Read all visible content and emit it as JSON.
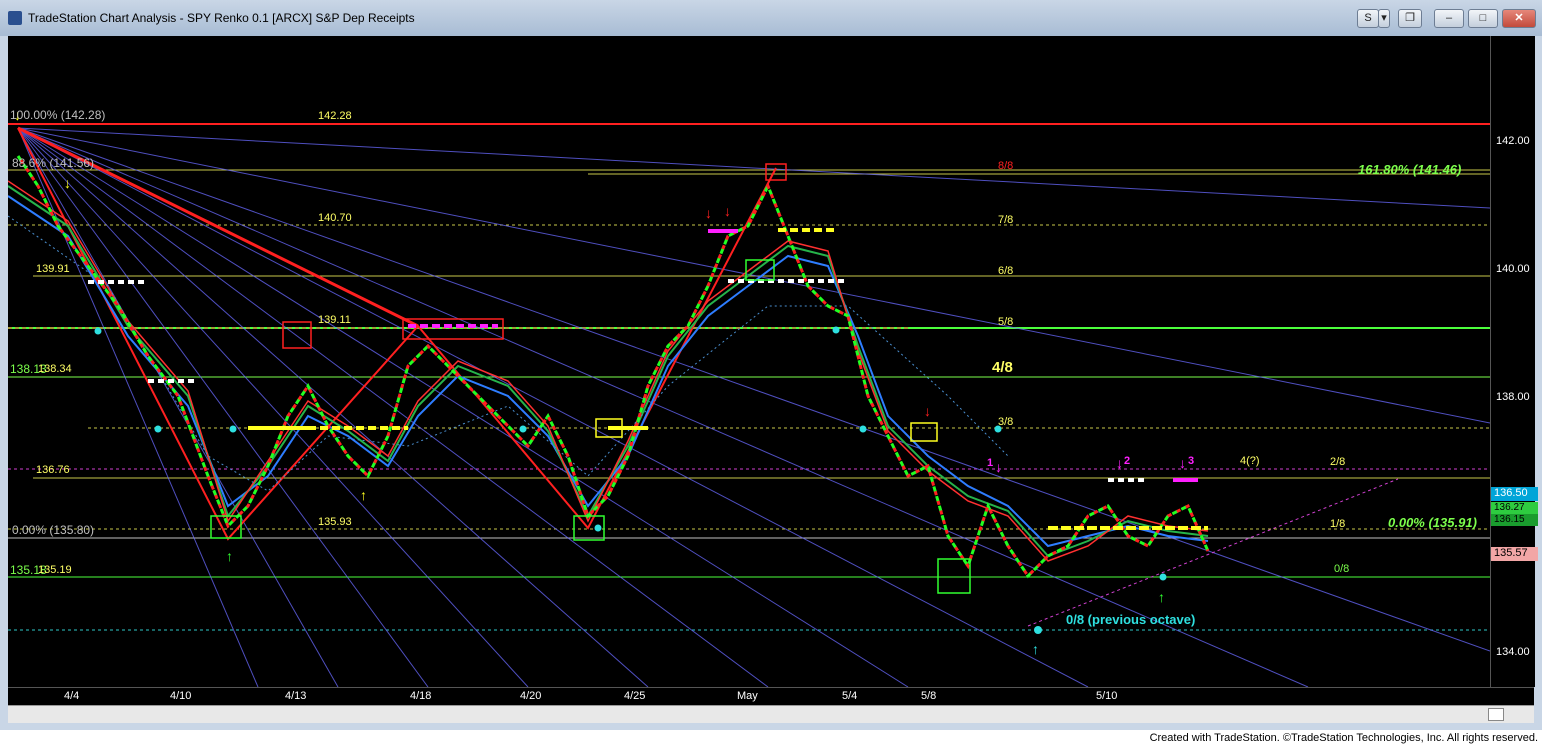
{
  "window": {
    "title": "TradeStation Chart Analysis - SPY Renko 0.1 [ARCX] S&P Dep Receipts",
    "buttons": {
      "s": "S",
      "menu": "▾",
      "restore": "❐",
      "minimize": "–",
      "maximize": "□",
      "close": "✕"
    }
  },
  "footer": "Created with TradeStation. ©TradeStation Technologies, Inc. All rights reserved.",
  "price_axis": {
    "ticks": [
      "142.00",
      "140.00",
      "138.00",
      "134.00"
    ],
    "badges": [
      {
        "text": "136.50",
        "bg": "#00a5d8"
      },
      {
        "text": "136.27",
        "bg": "#2ecc40"
      },
      {
        "text": "136.15",
        "bg": "#1a9c2e"
      },
      {
        "text": "135.57",
        "bg": "#f2a6a6"
      }
    ]
  },
  "date_axis": [
    "4/4",
    "4/10",
    "4/13",
    "4/18",
    "4/20",
    "4/25",
    "May",
    "5/4",
    "5/8",
    "5/10"
  ],
  "levels_left": [
    {
      "text": "100.00% (142.28)",
      "color": "#bfbfbf"
    },
    {
      "text": "142.28",
      "color": "#ffff66"
    },
    {
      "text": "88.6% (141.56)",
      "color": "#bfbfbf"
    },
    {
      "text": "140.70",
      "color": "#ffff66"
    },
    {
      "text": "139.91",
      "color": "#ffff66"
    },
    {
      "text": "139.11",
      "color": "#ffff66"
    },
    {
      "text": "138.13",
      "color": "#7cff4c"
    },
    {
      "text": "138.34",
      "color": "#ffff66"
    },
    {
      "text": "136.76",
      "color": "#ffff66"
    },
    {
      "text": "0.00% (135.80)",
      "color": "#bfbfbf"
    },
    {
      "text": "135.93",
      "color": "#ffff66"
    },
    {
      "text": "135.18",
      "color": "#7cff4c"
    },
    {
      "text": "135.19",
      "color": "#ffff66"
    }
  ],
  "octaves": [
    {
      "text": "8/8",
      "color": "#ff2020"
    },
    {
      "text": "7/8",
      "color": "#ffff66"
    },
    {
      "text": "6/8",
      "color": "#ffff66"
    },
    {
      "text": "5/8",
      "color": "#ffff66"
    },
    {
      "text": "4/8",
      "color": "#ffff66"
    },
    {
      "text": "3/8",
      "color": "#ffff66"
    },
    {
      "text": "2/8",
      "color": "#ffff66"
    },
    {
      "text": "1/8",
      "color": "#ffff66"
    },
    {
      "text": "0/8",
      "color": "#7cff4c"
    }
  ],
  "annotations": {
    "fib_161": "161.80% (141.46)",
    "fib_0": "0.00% (135.91)",
    "prev_octave": "0/8 (previous octave)",
    "wave_4": "4(?)",
    "wave_1": "1",
    "wave_2": "2",
    "wave_3": "3"
  }
}
